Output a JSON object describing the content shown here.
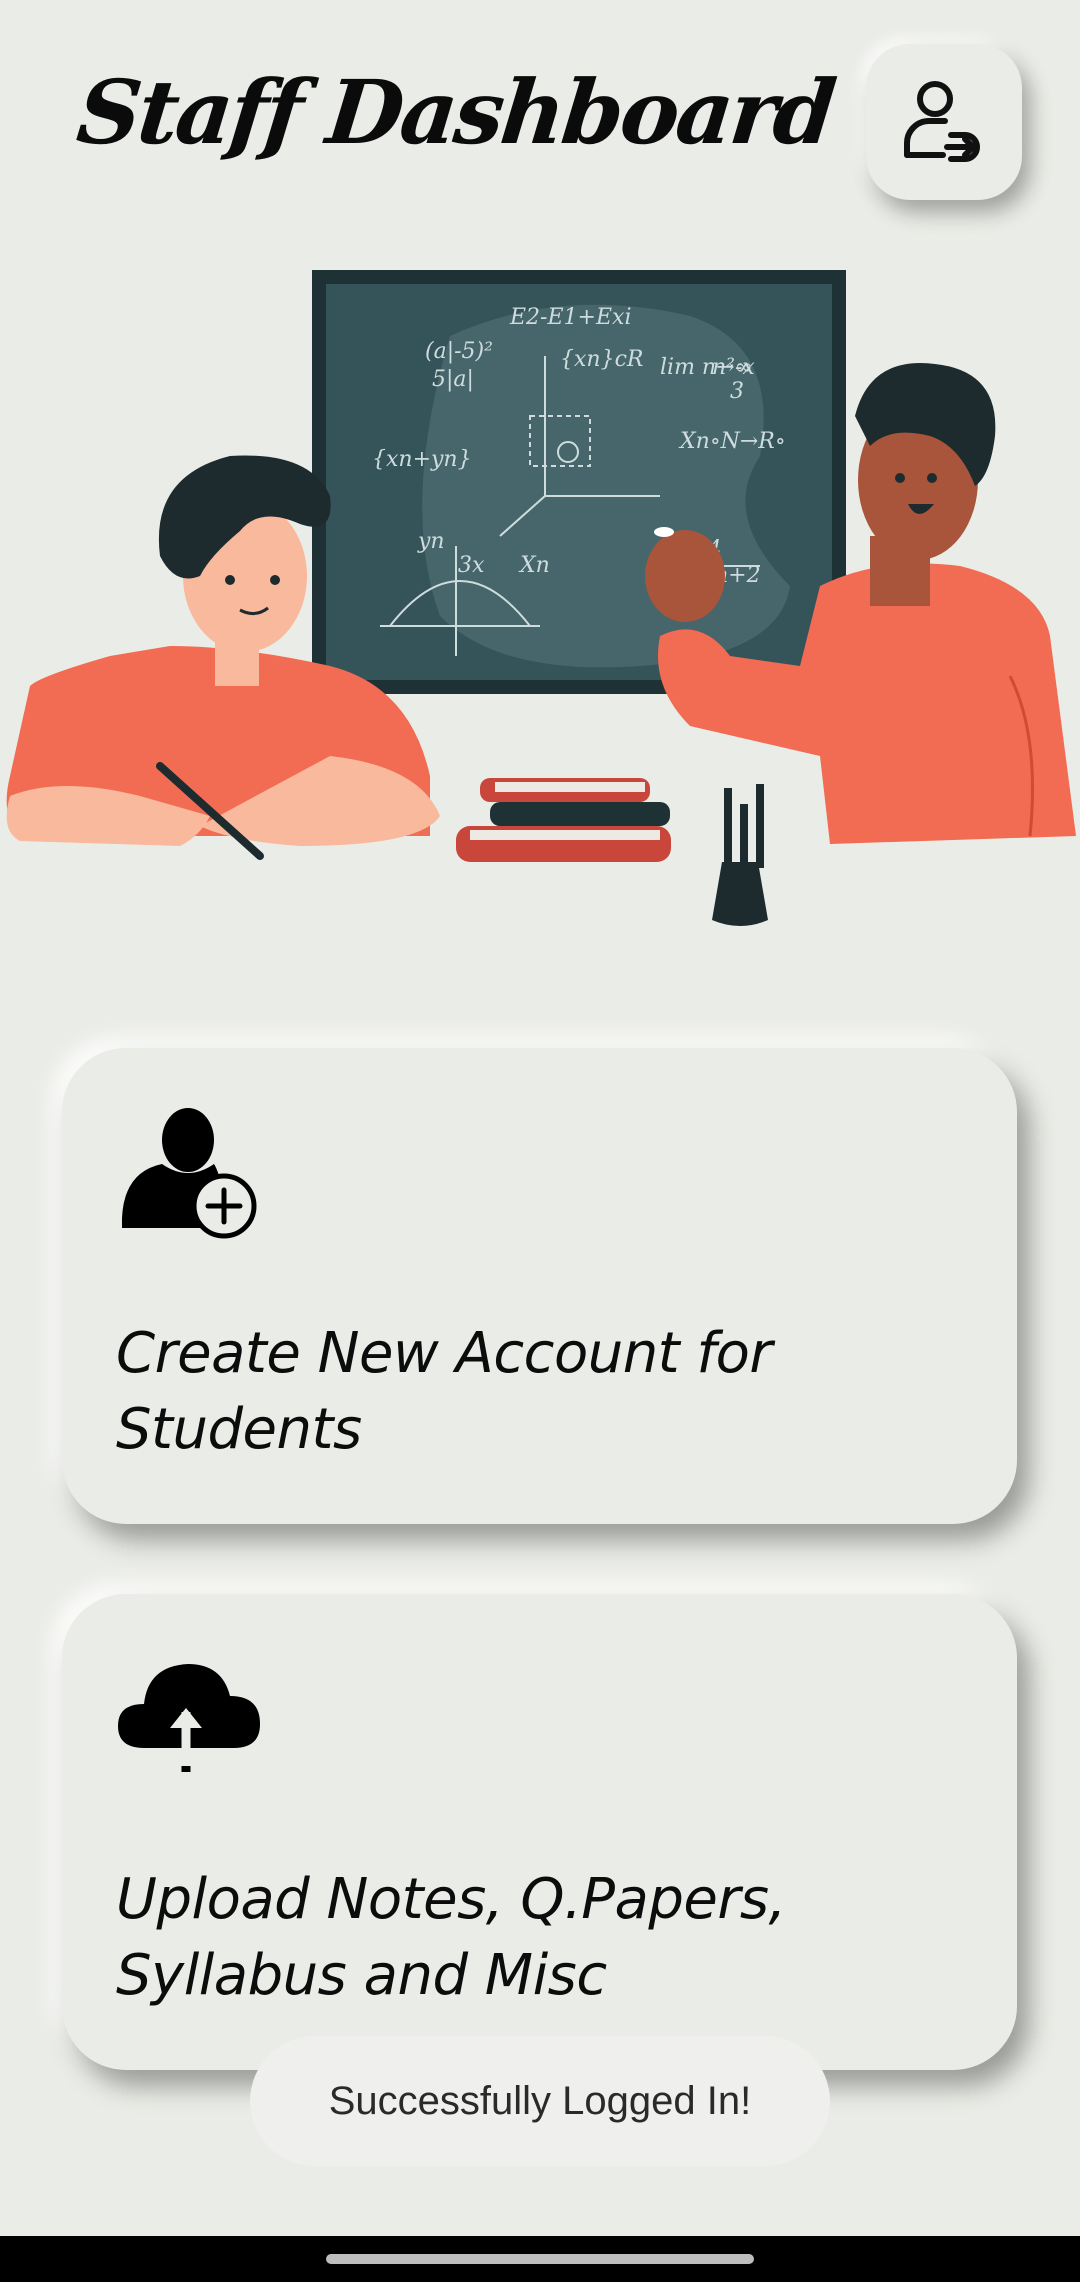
{
  "header": {
    "title": "Staff Dashboard",
    "logout_icon": "user-logout-icon"
  },
  "hero": {
    "illustration": "teacher-and-student-at-chalkboard-illustration",
    "board_formulas": [
      "E2-E1+Exi",
      "(a|-5)²",
      "5|a|",
      "{xn}cR",
      "lim n→∞",
      "n²-x",
      "3",
      "{xn+yn}",
      "Xn∘N→R∘",
      "yn",
      "3x",
      "Xn",
      "-4",
      "2n+2"
    ]
  },
  "cards": [
    {
      "label": "Create New Account for Students",
      "icon": "add-user-icon"
    },
    {
      "label": "Upload Notes, Q.Papers, Syllabus and Misc",
      "icon": "cloud-upload-icon"
    }
  ],
  "toast": {
    "message": "Successfully Logged In!"
  },
  "colors": {
    "background": "#EAECE7",
    "accent_shirt": "#F26B53",
    "chalkboard": "#2F4B50",
    "text": "#0B0B0B"
  }
}
